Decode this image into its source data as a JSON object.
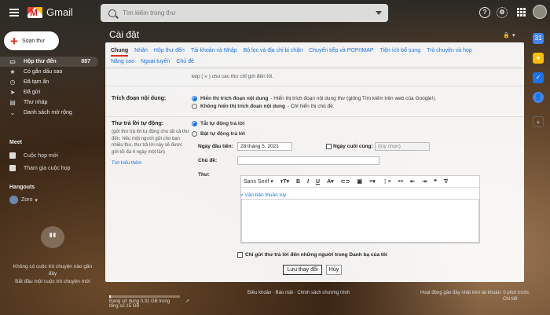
{
  "app": {
    "name": "Gmail"
  },
  "search": {
    "placeholder": "Tìm kiếm trong thư"
  },
  "compose": {
    "label": "Soạn thư"
  },
  "sidebar": {
    "items": [
      {
        "label": "Hộp thư đến",
        "count": "887",
        "icon": "inbox-icon"
      },
      {
        "label": "Có gắn dấu sao",
        "icon": "star-icon"
      },
      {
        "label": "Đã tạm ẩn",
        "icon": "clock-icon"
      },
      {
        "label": "Đã gửi",
        "icon": "send-icon"
      },
      {
        "label": "Thư nháp",
        "icon": "draft-icon"
      },
      {
        "label": "Danh sách mở rộng",
        "icon": "chevron-down-icon"
      }
    ]
  },
  "meet": {
    "title": "Meet",
    "new_meeting": "Cuộc họp mới",
    "join_meeting": "Tham gia cuộc họp"
  },
  "hangouts": {
    "title": "Hangouts",
    "user": "Zoro",
    "empty_text": "Không có cuộc trò chuyện nào gần đây",
    "start_link": "Bắt đầu một cuộc trò chuyện mới"
  },
  "settings": {
    "title": "Cài đặt",
    "tabs": [
      "Chung",
      "Nhãn",
      "Hộp thư đến",
      "Tài khoản và Nhập",
      "Bộ lọc và địa chỉ bị chặn",
      "Chuyển tiếp và POP/IMAP",
      "Tiện ích bổ sung",
      "Trò chuyện và họp",
      "Nâng cao",
      "Ngoại tuyến",
      "Chủ đề"
    ],
    "active_tab": "Chung",
    "prev_text": "kép ( » ) cho các thư chỉ gửi đến tôi.",
    "snippets": {
      "label": "Trích đoạn nội dung:",
      "opt_on_bold": "Hiển thị trích đoạn nội dung",
      "opt_on_desc": "- Hiển thị trích đoạn nội dung thư (giống Tìm kiếm trên web của Google!).",
      "opt_off_bold": "Không hiển thị trích đoạn nội dung",
      "opt_off_desc": "- Chỉ hiển thị chủ đề."
    },
    "vacation": {
      "label": "Thư trả lời tự động:",
      "desc": "(gửi thư trả lời tự động cho tất cả thư đến. Nếu một người gửi cho bạn nhiều thư, thư trả lời này sẽ được gửi tối đa 4 ngày một lần)",
      "learn_more": "Tìm hiểu thêm",
      "off": "Tắt tự động trả lời",
      "on": "Bật tự động trả lời",
      "first_day_label": "Ngày đầu tiên:",
      "first_day_value": "28 tháng 5, 2021",
      "last_day_label": "Ngày cuối cùng:",
      "last_day_placeholder": "(tùy chọn)",
      "subject_label": "Chủ đề:",
      "message_label": "Thư:",
      "font": "Sans Serif",
      "plain_text": "« Văn bản thuần túy",
      "contacts_only": "Chỉ gửi thư trả lời đến những người trong Danh bạ của tôi"
    },
    "save": "Lưu thay đổi",
    "cancel": "Hủy"
  },
  "footer": {
    "storage": "Đang sử dụng 0,31 GB trong tổng số 15 GB",
    "storage_fraction": 0.02,
    "terms": "Điều khoản · Bảo mật · Chính sách chương trình",
    "activity": "Hoạt động gần đây nhất trên tài khoản: 0 phút trước",
    "details": "Chi tiết"
  },
  "colors": {
    "accent": "#1a73e8",
    "compose_plus": "#d93025"
  }
}
